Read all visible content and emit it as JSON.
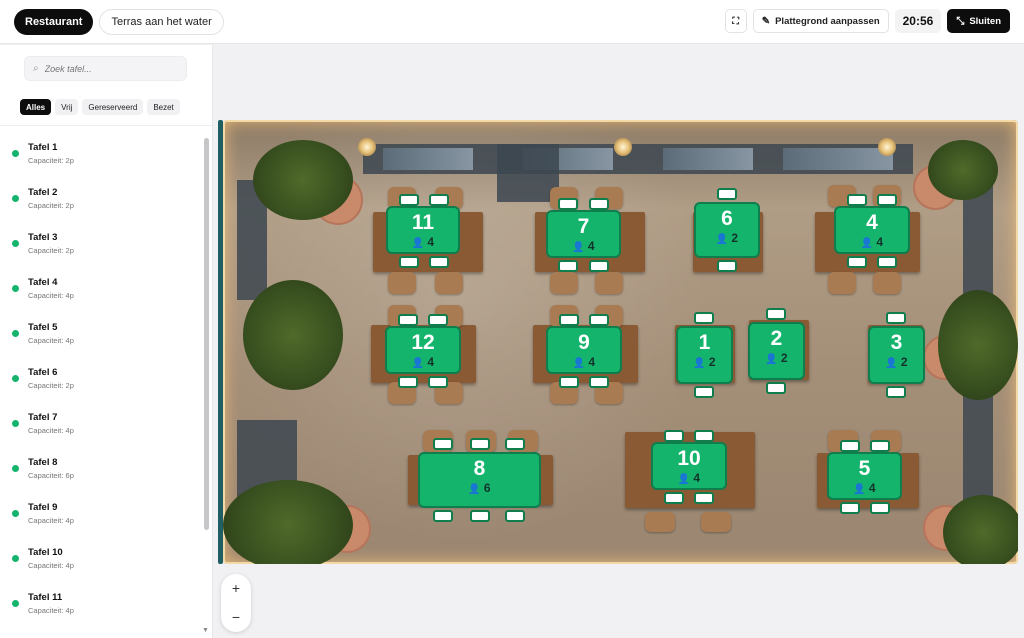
{
  "header": {
    "section_tab": "Restaurant",
    "area_tab": "Terras aan het water",
    "edit_floorplan_label": "Plattegrond aanpassen",
    "clock": "20:56",
    "close_label": "Sluiten"
  },
  "sidebar": {
    "search_placeholder": "Zoek tafel...",
    "filters": [
      "Alles",
      "Vrij",
      "Gereserveerd",
      "Bezet"
    ],
    "tables": [
      {
        "name": "Tafel 1",
        "capacity": "Capaciteit: 2p"
      },
      {
        "name": "Tafel 2",
        "capacity": "Capaciteit: 2p"
      },
      {
        "name": "Tafel 3",
        "capacity": "Capaciteit: 2p"
      },
      {
        "name": "Tafel 4",
        "capacity": "Capaciteit: 4p"
      },
      {
        "name": "Tafel 5",
        "capacity": "Capaciteit: 4p"
      },
      {
        "name": "Tafel 6",
        "capacity": "Capaciteit: 2p"
      },
      {
        "name": "Tafel 7",
        "capacity": "Capaciteit: 4p"
      },
      {
        "name": "Tafel 8",
        "capacity": "Capaciteit: 6p"
      },
      {
        "name": "Tafel 9",
        "capacity": "Capaciteit: 4p"
      },
      {
        "name": "Tafel 10",
        "capacity": "Capaciteit: 4p"
      },
      {
        "name": "Tafel 11",
        "capacity": "Capaciteit: 4p"
      }
    ]
  },
  "floorplan": {
    "markers": [
      {
        "num": "11",
        "seats": "4"
      },
      {
        "num": "7",
        "seats": "4"
      },
      {
        "num": "6",
        "seats": "2"
      },
      {
        "num": "4",
        "seats": "4"
      },
      {
        "num": "12",
        "seats": "4"
      },
      {
        "num": "9",
        "seats": "4"
      },
      {
        "num": "1",
        "seats": "2"
      },
      {
        "num": "2",
        "seats": "2"
      },
      {
        "num": "3",
        "seats": "2"
      },
      {
        "num": "8",
        "seats": "6"
      },
      {
        "num": "10",
        "seats": "4"
      },
      {
        "num": "5",
        "seats": "4"
      }
    ]
  },
  "zoom": {
    "in": "+",
    "out": "−"
  },
  "colors": {
    "free": "#15b46d",
    "accent": "#0d0d0d"
  }
}
